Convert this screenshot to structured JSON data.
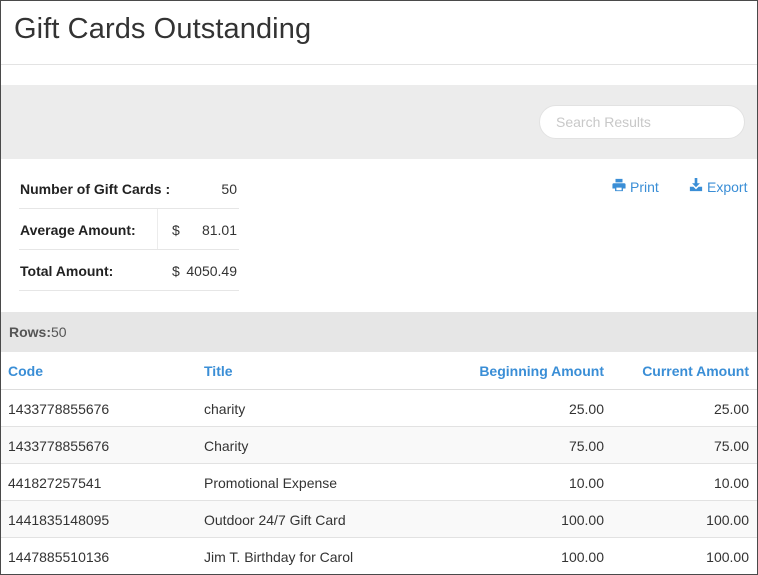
{
  "page": {
    "title": "Gift Cards Outstanding"
  },
  "search": {
    "placeholder": "Search Results",
    "value": ""
  },
  "summary": {
    "count_label": "Number of Gift Cards :",
    "count_value": "50",
    "average_label": "Average Amount:",
    "average_currency": "$",
    "average_value": "81.01",
    "total_label": "Total Amount:",
    "total_currency": "$",
    "total_value": "4050.49"
  },
  "actions": {
    "print_label": "Print",
    "export_label": "Export"
  },
  "rows": {
    "label": "Rows:",
    "count": "50"
  },
  "table": {
    "headers": {
      "code": "Code",
      "title": "Title",
      "beginning": "Beginning Amount",
      "current": "Current Amount"
    },
    "rows": [
      {
        "code": "1433778855676",
        "title": "charity",
        "beginning": "25.00",
        "current": "25.00"
      },
      {
        "code": "1433778855676",
        "title": "Charity",
        "beginning": "75.00",
        "current": "75.00"
      },
      {
        "code": "441827257541",
        "title": "Promotional Expense",
        "beginning": "10.00",
        "current": "10.00"
      },
      {
        "code": "1441835148095",
        "title": "Outdoor 24/7 Gift Card",
        "beginning": "100.00",
        "current": "100.00"
      },
      {
        "code": "1447885510136",
        "title": "Jim T. Birthday for Carol",
        "beginning": "100.00",
        "current": "100.00"
      }
    ]
  },
  "colors": {
    "accent": "#3a8ed6",
    "band": "#ececec",
    "rows_band": "#e6e6e6"
  }
}
